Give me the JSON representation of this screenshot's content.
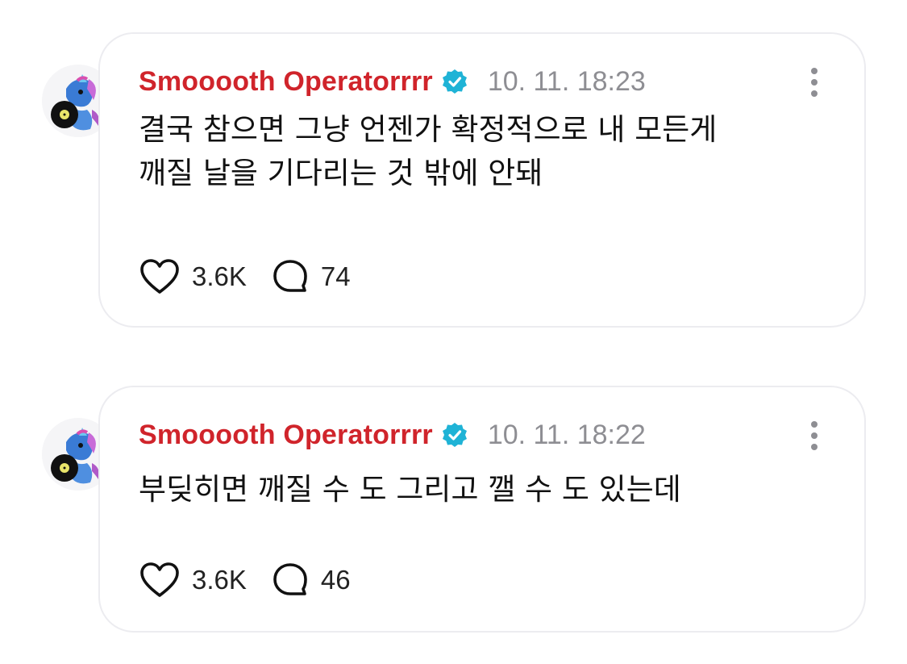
{
  "posts": [
    {
      "username": "Smooooth Operatorrrr",
      "timestamp": "10. 11. 18:23",
      "text": "결국 참으면 그냥 언젠가 확정적으로 내 모든게\n깨질 날을 기다리는 것 밖에 안돼",
      "likes": "3.6K",
      "comments": "74"
    },
    {
      "username": "Smooooth Operatorrrr",
      "timestamp": "10. 11. 18:22",
      "text": "부딪히면 깨질 수 도 그리고 깰 수 도 있는데",
      "likes": "3.6K",
      "comments": "46"
    }
  ],
  "colors": {
    "username": "#d0242b",
    "verified": "#1fb3d6",
    "timestamp": "#8e8e93",
    "card_border": "#ececf0"
  },
  "icons": {
    "verified": "verified-badge-icon",
    "more": "more-vertical-icon",
    "like": "heart-icon",
    "comment": "comment-bubble-icon"
  }
}
